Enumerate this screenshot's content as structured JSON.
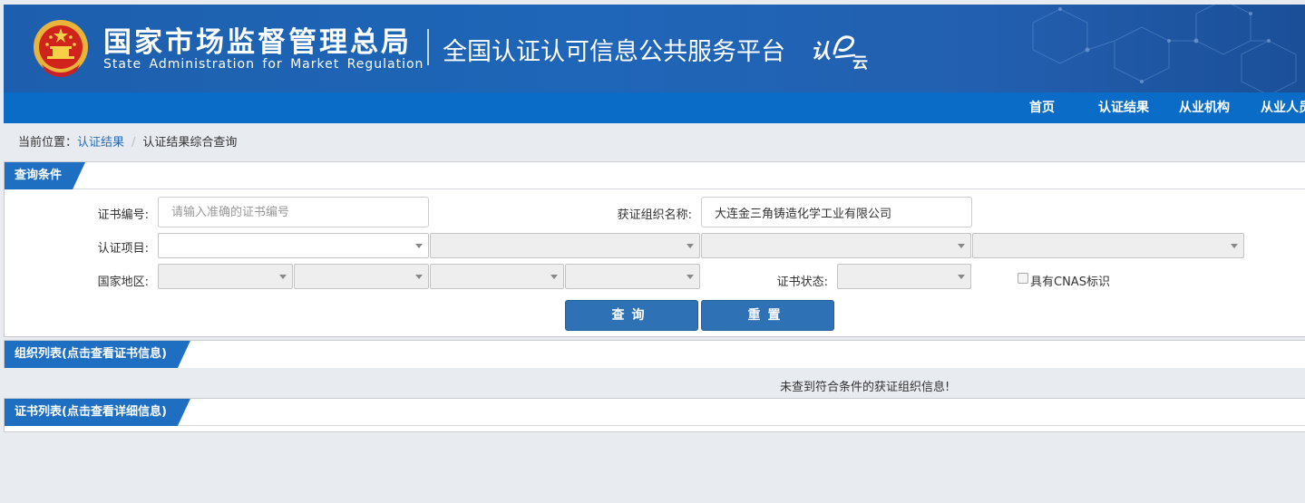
{
  "header": {
    "org_name_cn": "国家市场监督管理总局",
    "org_name_en": "State Administration  for  Market Regulation",
    "platform_title": "全国认证认可信息公共服务平台",
    "logo_text": "认",
    "logo_sub": "云"
  },
  "nav": {
    "items": [
      {
        "label": "首页"
      },
      {
        "label": "认证结果"
      },
      {
        "label": "从业机构"
      },
      {
        "label": "从业人员"
      }
    ]
  },
  "breadcrumb": {
    "prefix": "当前位置：",
    "link": "认证结果",
    "current": "认证结果综合查询"
  },
  "query_panel": {
    "title": "查询条件",
    "cert_no_label": "证书编号:",
    "cert_no_placeholder": "请输入准确的证书编号",
    "cert_no_value": "",
    "org_name_label": "获证组织名称:",
    "org_name_value": "大连金三角铸造化学工业有限公司",
    "project_label": "认证项目:",
    "region_label": "国家地区:",
    "status_label": "证书状态:",
    "cnas_label": "具有CNAS标识",
    "search_button": "查询",
    "reset_button": "重置"
  },
  "org_list_panel": {
    "title": "组织列表(点击查看证书信息)",
    "empty_message": "未查到符合条件的获证组织信息!"
  },
  "cert_list_panel": {
    "title": "证书列表(点击查看详细信息)"
  },
  "colors": {
    "header_blue": "#1f66b8",
    "nav_blue": "#0a6cc7",
    "tab_blue": "#1e6fc2",
    "button_blue": "#2f71b5"
  }
}
